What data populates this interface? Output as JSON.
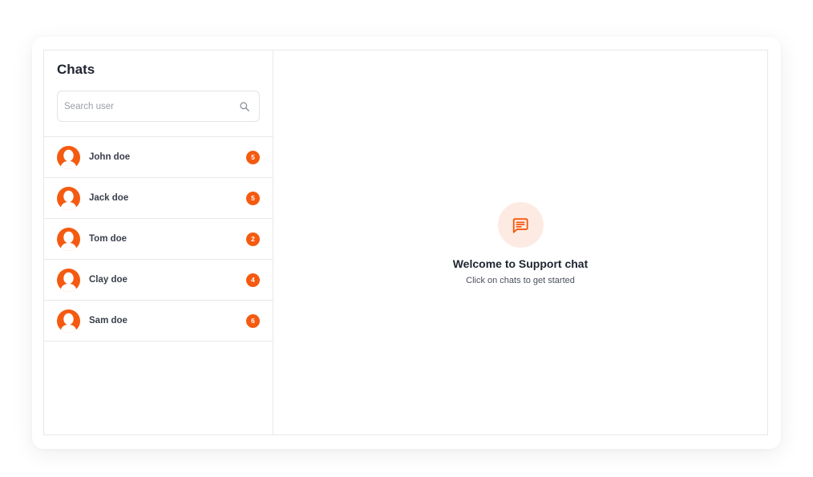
{
  "sidebar": {
    "title": "Chats",
    "search": {
      "placeholder": "Search user",
      "value": ""
    },
    "items": [
      {
        "name": "John doe",
        "unread": "5"
      },
      {
        "name": "Jack doe",
        "unread": "5"
      },
      {
        "name": "Tom doe",
        "unread": "2"
      },
      {
        "name": "Clay doe",
        "unread": "4"
      },
      {
        "name": "Sam doe",
        "unread": "6"
      }
    ]
  },
  "main": {
    "welcome_icon": "chat-message-icon",
    "welcome_title": "Welcome to Support chat",
    "welcome_subtitle": "Click on chats to get started"
  },
  "icons": {
    "search": "search-icon",
    "avatar": "user-avatar-icon"
  },
  "colors": {
    "accent": "#f45a10",
    "accent_soft": "#fdebe3",
    "border": "#e8e8ec",
    "text_primary": "#1f2430",
    "text_secondary": "#4b5060"
  }
}
